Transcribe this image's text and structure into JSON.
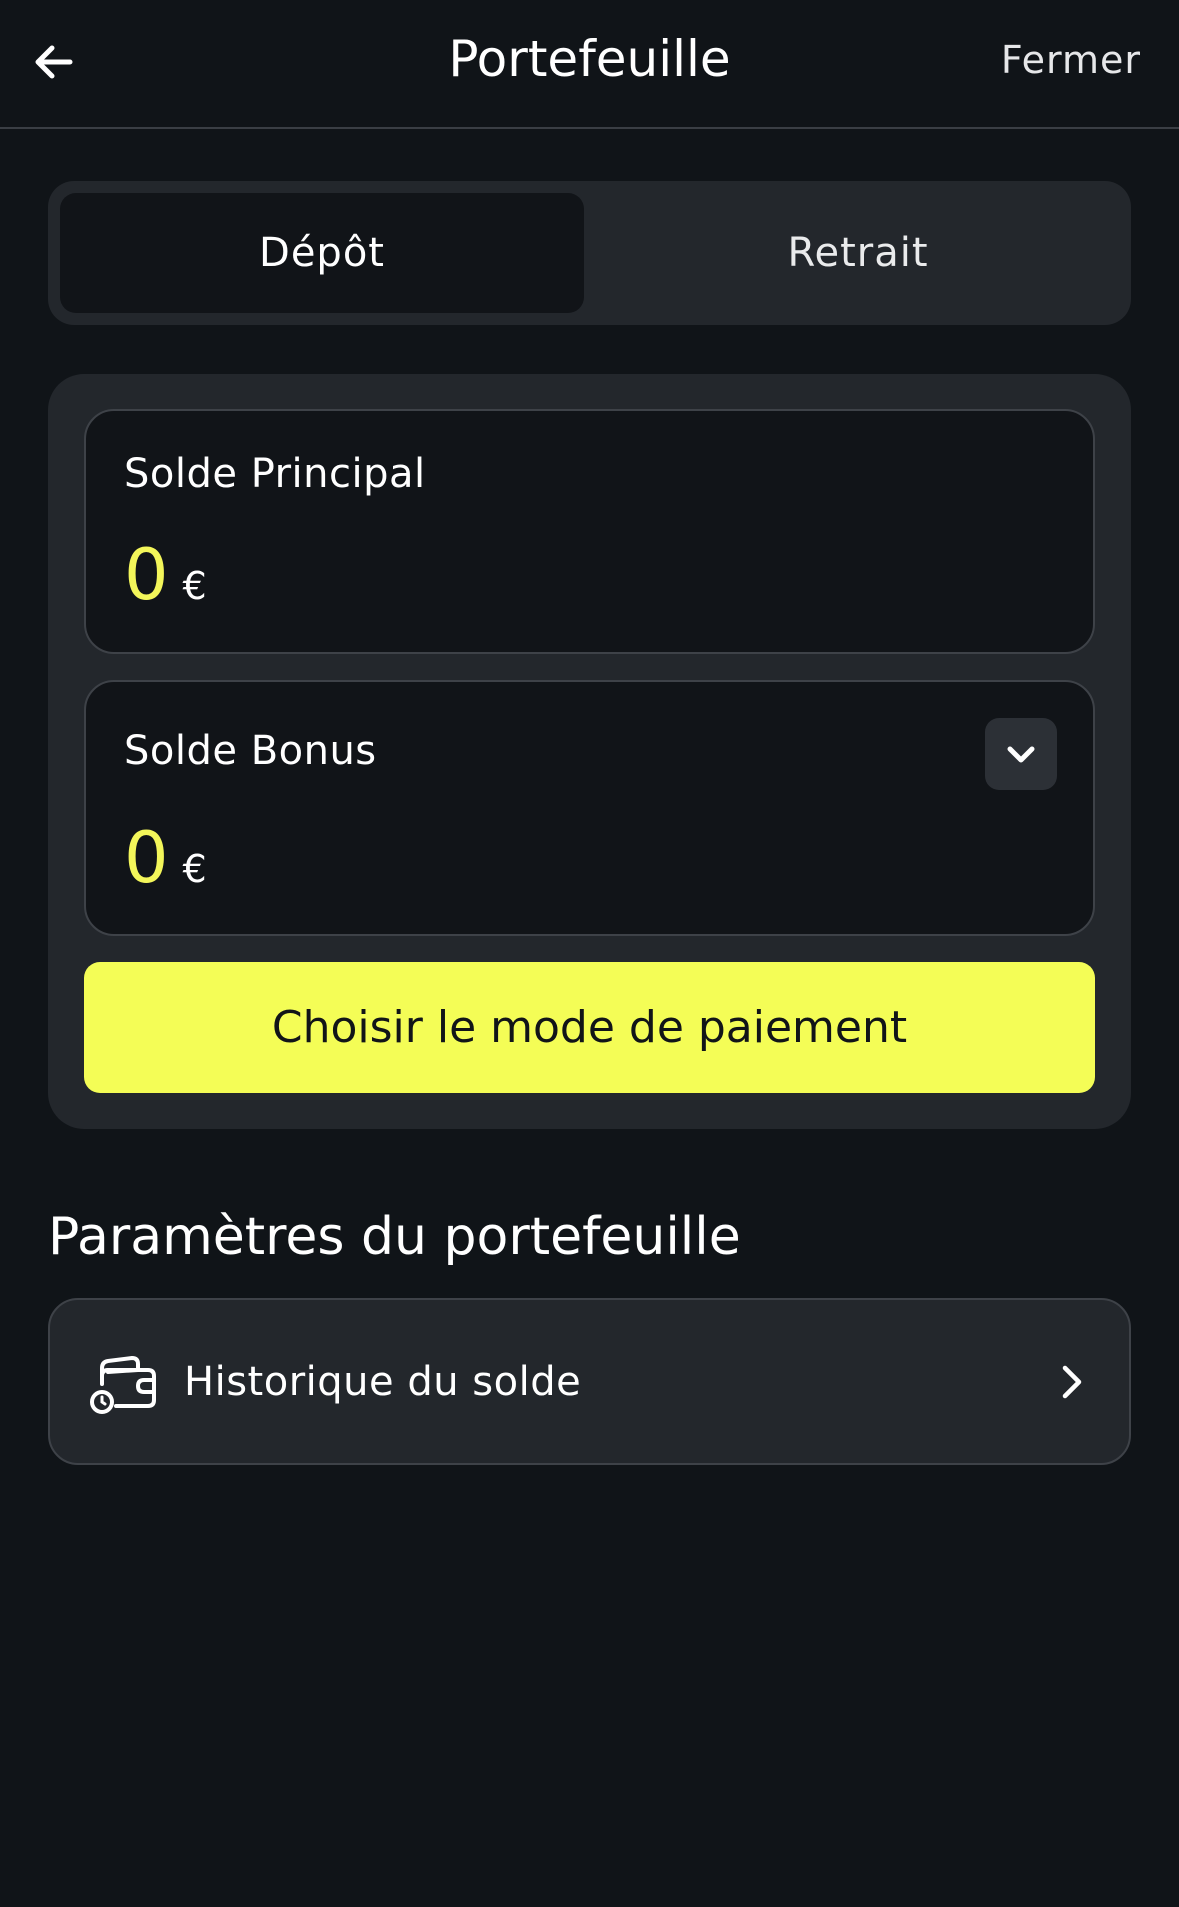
{
  "header": {
    "title": "Portefeuille",
    "close_label": "Fermer",
    "back_icon": "arrow-left-icon"
  },
  "tabs": [
    {
      "label": "Dépôt",
      "active": true
    },
    {
      "label": "Retrait",
      "active": false
    }
  ],
  "balances": {
    "main": {
      "label": "Solde Principal",
      "amount": "0",
      "currency": "€"
    },
    "bonus": {
      "label": "Solde Bonus",
      "amount": "0",
      "currency": "€",
      "expand_icon": "chevron-down-icon"
    }
  },
  "pay_button_label": "Choisir le mode de paiement",
  "wallet_settings": {
    "title": "Paramètres du portefeuille",
    "items": [
      {
        "label": "Historique du solde",
        "icon": "wallet-history-icon",
        "chevron": "chevron-right-icon"
      }
    ]
  },
  "colors": {
    "background": "#101418",
    "panel": "#23272c",
    "card": "#111418",
    "accent": "#f4fd56",
    "amount": "#f3f65a"
  }
}
